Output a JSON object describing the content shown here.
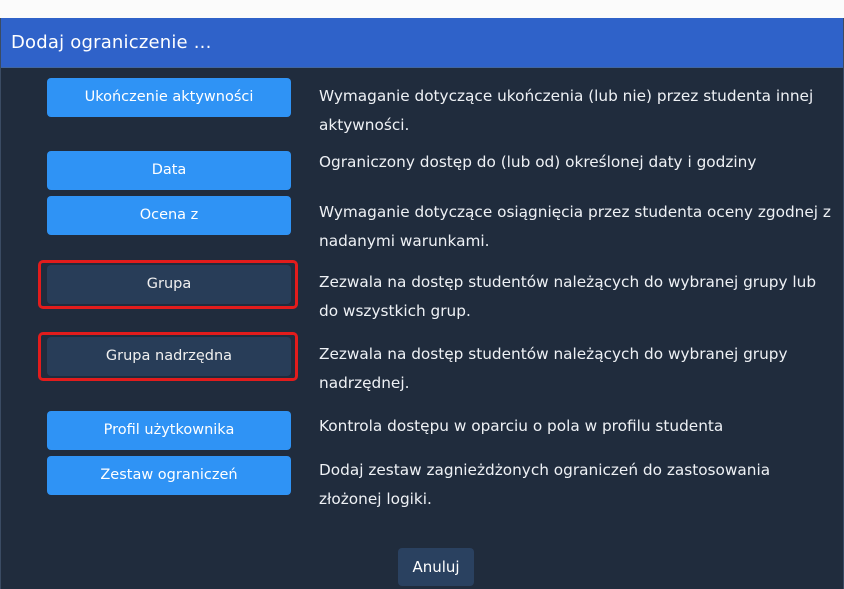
{
  "dialog": {
    "title": "Dodaj ograniczenie ..."
  },
  "options": [
    {
      "label": "Ukończenie aktywności",
      "description": "Wymaganie dotyczące ukończenia (lub nie) przez studenta innej aktywności.",
      "highlighted": false
    },
    {
      "label": "Data",
      "description": "Ograniczony dostęp do (lub od) określonej daty i godziny",
      "highlighted": false
    },
    {
      "label": "Ocena z",
      "description": "Wymaganie dotyczące osiągnięcia przez studenta oceny zgodnej z nadanymi warunkami.",
      "highlighted": false
    },
    {
      "label": "Grupa",
      "description": "Zezwala na dostęp studentów należących do wybranej grupy lub do wszystkich grup.",
      "highlighted": true
    },
    {
      "label": "Grupa nadrzędna",
      "description": "Zezwala na dostęp studentów należących do wybranej grupy nadrzędnej.",
      "highlighted": true
    },
    {
      "label": "Profil użytkownika",
      "description": "Kontrola dostępu w oparciu o pola w profilu studenta",
      "highlighted": false
    },
    {
      "label": "Zestaw ograniczeń",
      "description": "Dodaj zestaw zagnieżdżonych ograniczeń do zastosowania złożonej logiki.",
      "highlighted": false
    }
  ],
  "footer": {
    "cancel_label": "Anuluj"
  },
  "colors": {
    "header": "#2f62c9",
    "primary_button": "#2f93f5",
    "selected_button": "#283d58",
    "highlight_border": "#e21c1c",
    "dialog_background": "#202c3d"
  }
}
